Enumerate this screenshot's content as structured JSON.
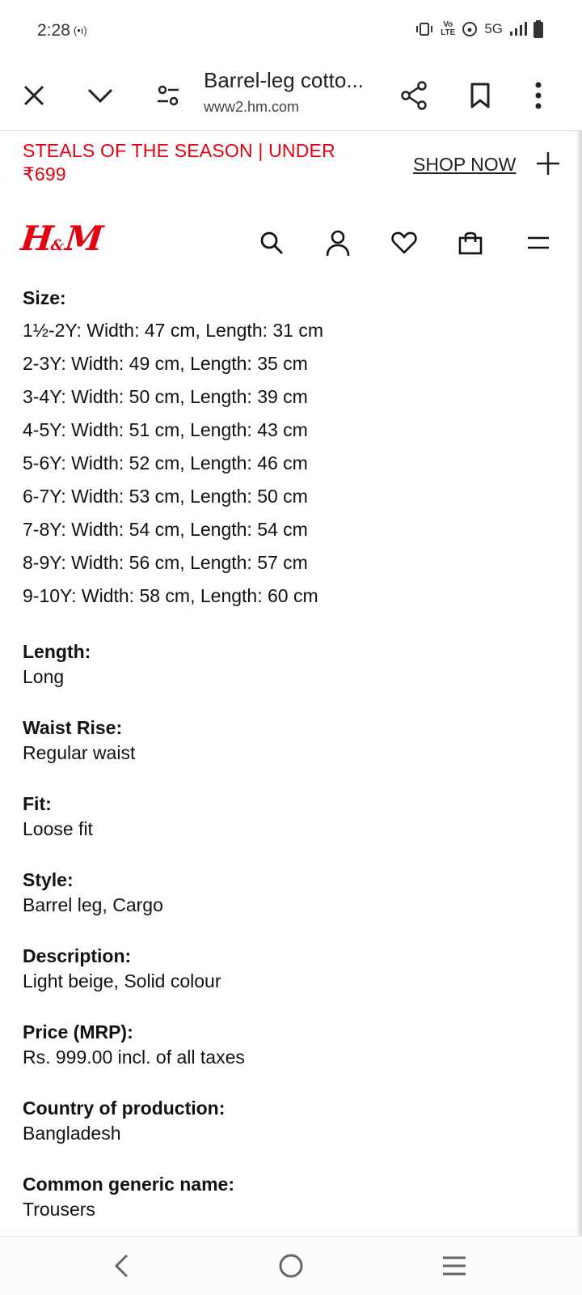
{
  "status": {
    "time": "2:28",
    "network": "5G",
    "lte": "LTE",
    "volte": "Vo"
  },
  "browser": {
    "page_title": "Barrel-leg cotto...",
    "url": "www2.hm.com",
    "icons": [
      "close-icon",
      "chevron-down-icon",
      "site-settings-icon",
      "share-icon",
      "bookmark-icon",
      "more-vert-icon"
    ]
  },
  "promo": {
    "line1": "STEALS OF THE SEASON | UNDER",
    "line2": "₹699",
    "cta": "SHOP NOW"
  },
  "brand": {
    "logo": "H&M",
    "brand_color": "#e50010",
    "icons": [
      "search-icon",
      "account-icon",
      "heart-icon",
      "bag-icon",
      "menu-icon"
    ]
  },
  "details": {
    "size_label": "Size:",
    "sizes": [
      "1½-2Y: Width: 47 cm, Length: 31 cm",
      "2-3Y: Width: 49 cm, Length: 35 cm",
      "3-4Y: Width: 50 cm, Length: 39 cm",
      "4-5Y: Width: 51 cm, Length: 43 cm",
      "5-6Y: Width: 52 cm, Length: 46 cm",
      "6-7Y: Width: 53 cm, Length: 50 cm",
      "7-8Y: Width: 54 cm, Length: 54 cm",
      "8-9Y: Width: 56 cm, Length: 57 cm",
      "9-10Y: Width: 58 cm, Length: 60 cm"
    ],
    "fields": [
      {
        "label": "Length:",
        "value": "Long"
      },
      {
        "label": "Waist Rise:",
        "value": "Regular waist"
      },
      {
        "label": "Fit:",
        "value": "Loose fit"
      },
      {
        "label": "Style:",
        "value": "Barrel leg, Cargo"
      },
      {
        "label": "Description:",
        "value": "Light beige, Solid colour"
      },
      {
        "label": "Price (MRP):",
        "value": "Rs. 999.00 incl. of all taxes"
      },
      {
        "label": "Country of production:",
        "value": "Bangladesh"
      },
      {
        "label": "Common generic name:",
        "value": "Trousers"
      }
    ]
  },
  "navbar": {
    "icons": [
      "back-icon",
      "home-icon",
      "recents-icon"
    ]
  }
}
